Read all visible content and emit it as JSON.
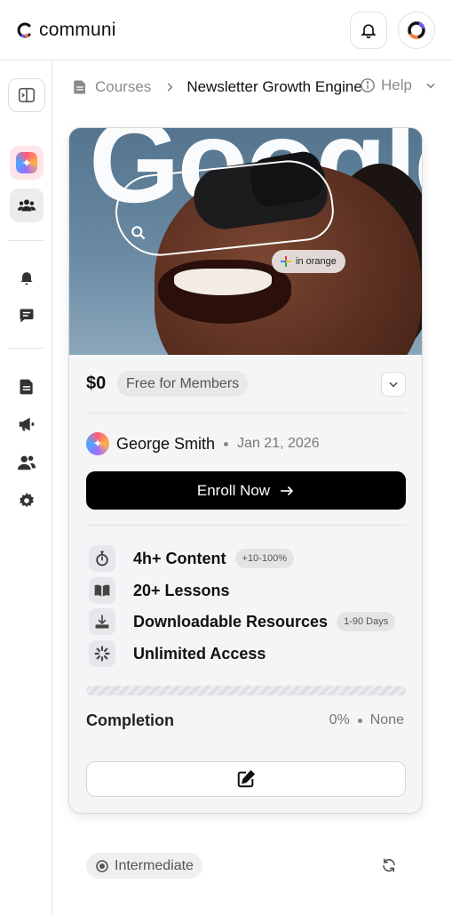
{
  "app": {
    "name": "communi"
  },
  "breadcrumb": {
    "root": "Courses",
    "current": "Newsletter Growth Engine"
  },
  "help": {
    "label": "Help"
  },
  "hero": {
    "word": "Google",
    "chip": "in orange"
  },
  "course": {
    "price": "$0",
    "price_tag": "Free for Members",
    "author": "George Smith",
    "date": "Jan 21, 2026",
    "enroll_label": "Enroll Now",
    "features": [
      {
        "icon": "timer-icon",
        "label": "4h+ Content",
        "badge": "+10-100%"
      },
      {
        "icon": "book-icon",
        "label": "20+ Lessons",
        "badge": ""
      },
      {
        "icon": "download-icon",
        "label": "Downloadable Resources",
        "badge": "1-90 Days"
      },
      {
        "icon": "loader-icon",
        "label": "Unlimited Access",
        "badge": ""
      }
    ],
    "completion_label": "Completion",
    "completion_percent": "0%",
    "completion_status": "None",
    "progress": 0
  },
  "footer": {
    "level": "Intermediate"
  },
  "colors": {
    "accent": "#000000",
    "card_bg": "#f4f5f7",
    "muted": "#8a8a8a"
  }
}
